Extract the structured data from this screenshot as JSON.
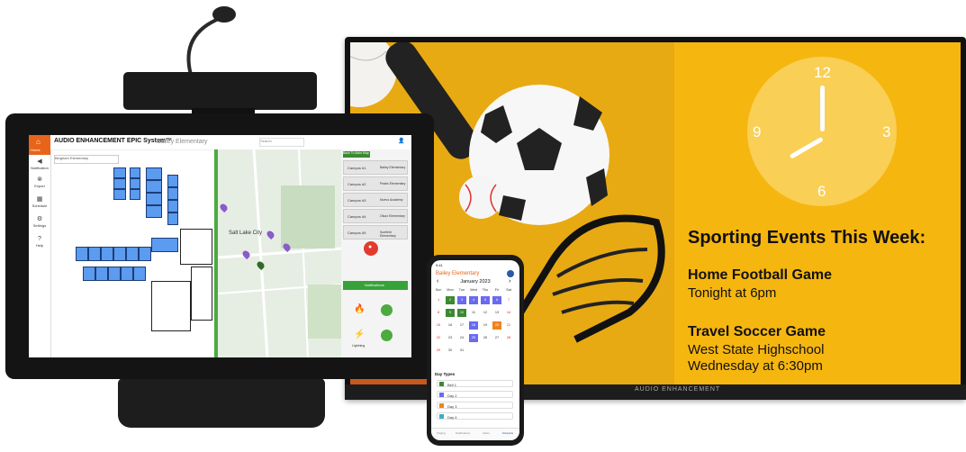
{
  "colors": {
    "accent_orange": "#e8641b",
    "green": "#4caa3e",
    "blue_room": "#5b9bf0",
    "yellow": "#f6b610"
  },
  "tv": {
    "brand": "AUDIO ENHANCEMENT",
    "clock": {
      "n12": "12",
      "n3": "3",
      "n6": "6",
      "n9": "9"
    },
    "heading": "Sporting Events This Week:",
    "events": [
      {
        "title": "Home Football Game",
        "lines": [
          "Tonight at 6pm"
        ]
      },
      {
        "title": "Travel Soccer Game",
        "lines": [
          "West State Highschool",
          "Wednesday at 6:30pm"
        ]
      }
    ]
  },
  "tablet": {
    "brand": "AUDIO ENHANCEMENT EPIC System™",
    "school": "Bailey Elementary",
    "search_placeholder": "Search",
    "dropdown": "Bingham Elementary",
    "sidebar": [
      {
        "label": "Home",
        "icon": "home-icon"
      },
      {
        "label": "Notification",
        "icon": "speaker-icon"
      },
      {
        "label": "Export",
        "icon": "export-icon"
      },
      {
        "label": "Schedule",
        "icon": "calendar-icon"
      },
      {
        "label": "Settings",
        "icon": "gear-icon"
      },
      {
        "label": "Help",
        "icon": "help-icon"
      }
    ],
    "map_city": "Salt Lake City",
    "back_button": "Back To Main Map",
    "campuses": [
      {
        "name": "Campus #1",
        "school": "Bailey Elementary"
      },
      {
        "name": "Campus #2",
        "school": "Peaks Elementary"
      },
      {
        "name": "Campus #3",
        "school": "Nuevo Academy"
      },
      {
        "name": "Campus #4",
        "school": "Olson Elementary"
      },
      {
        "name": "Campus #5",
        "school": "Sunfield Elementary"
      }
    ],
    "notifications_label": "Notifications",
    "lightning_label": "Lightning"
  },
  "phone": {
    "time": "9:41",
    "school": "Bailey Elementary",
    "month": "January 2023",
    "weekdays": [
      "Sun",
      "Mon",
      "Tue",
      "Wed",
      "Thu",
      "Fri",
      "Sat"
    ],
    "day_types_title": "Day Types",
    "day_types": [
      {
        "label": "Bell 1",
        "color": "#3a8a2f"
      },
      {
        "label": "Day 2",
        "color": "#6a6af0"
      },
      {
        "label": "Day 3",
        "color": "#f0821e"
      },
      {
        "label": "Day 4",
        "color": "#39aec9"
      }
    ],
    "tabs": [
      "Paging",
      "Notifications",
      "Alerts",
      "Schedule"
    ]
  }
}
